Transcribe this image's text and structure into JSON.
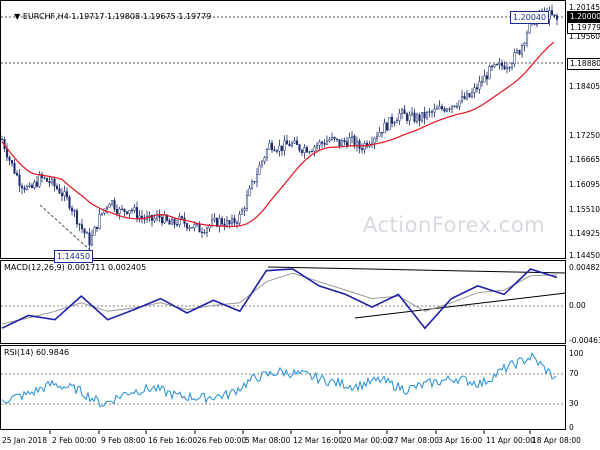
{
  "header": {
    "symbol": "EURCHF,H4",
    "quote": "1.19717 1.19808 1.19675 1.19779"
  },
  "watermark": "ActionForex.com",
  "price_axis": {
    "labels": [
      "1.20145",
      "1.20000",
      "1.19779",
      "1.19560",
      "1.18880",
      "1.18405",
      "1.17250",
      "1.16665",
      "1.16095",
      "1.15510",
      "1.14925",
      "1.14450"
    ],
    "current": "1.19779",
    "level_high": "1.20000",
    "level_support": "1.18880"
  },
  "callouts": {
    "high": "1.20040",
    "low": "1.14450"
  },
  "macd": {
    "label": "MACD(12,26,9) 0.001711 0.002405",
    "axis": [
      "0.004827",
      "0.00",
      "-0.004632"
    ]
  },
  "rsi": {
    "label": "RSI(14) 60.9846",
    "axis": [
      "100",
      "70",
      "30",
      "0"
    ]
  },
  "time_axis": [
    "25 Jan 2018",
    "2 Feb 00:00",
    "9 Feb 08:00",
    "16 Feb 16:00",
    "26 Feb 00:00",
    "5 Mar 08:00",
    "12 Mar 16:00",
    "20 Mar 00:00",
    "27 Mar 08:00",
    "3 Apr 16:00",
    "11 Apr 00:00",
    "18 Apr 08:00"
  ],
  "colors": {
    "price": "#1a2b6e",
    "ma": "#e8121f",
    "macd": "#1f1fa8",
    "signal": "#9a9a9a",
    "rsi": "#1f8fd8",
    "grid": "#000000"
  },
  "chart_data": [
    {
      "type": "line",
      "title": "EURCHF,H4",
      "series": [
        {
          "name": "EURCHF,H4",
          "x": [
            "25 Jan 2018",
            "2 Feb 00:00",
            "9 Feb 08:00",
            "16 Feb 16:00",
            "26 Feb 00:00",
            "5 Mar 08:00",
            "12 Mar 16:00",
            "20 Mar 00:00",
            "27 Mar 08:00",
            "3 Apr 16:00",
            "11 Apr 00:00",
            "18 Apr 08:00"
          ],
          "y": [
            1.166,
            1.162,
            1.148,
            1.152,
            1.151,
            1.159,
            1.167,
            1.168,
            1.174,
            1.178,
            1.184,
            1.199
          ]
        }
      ],
      "ylim": [
        1.1423,
        1.2023
      ],
      "grid": "off"
    },
    {
      "type": "line",
      "title": "MACD(12,26,9) 0.001711 0.002405",
      "series": [
        {
          "values": [
            -0.003,
            -0.0015,
            -0.002,
            0.0008,
            -0.002,
            -0.0008,
            0.0005,
            -0.0012,
            0.0003,
            -0.001,
            0.0038,
            0.004,
            0.002,
            0.001,
            -0.0005,
            0.001,
            -0.003,
            0.0005,
            0.002,
            0.001,
            0.004,
            0.003
          ]
        },
        {
          "values": [
            -0.0025,
            -0.0018,
            -0.001,
            0.0,
            -0.001,
            -0.0006,
            0.0,
            -0.0008,
            -0.0003,
            0.0,
            0.0025,
            0.0035,
            0.0025,
            0.0015,
            0.0005,
            0.0008,
            -0.001,
            0.0,
            0.0012,
            0.0015,
            0.0032,
            0.0033
          ]
        }
      ],
      "ylim": [
        -0.004632,
        0.004827
      ]
    },
    {
      "type": "line",
      "title": "RSI(14) 60.9846",
      "series": [
        {
          "values": [
            35,
            42,
            55,
            48,
            30,
            45,
            50,
            40,
            38,
            42,
            62,
            70,
            66,
            58,
            52,
            60,
            48,
            56,
            62,
            55,
            75,
            88,
            60
          ]
        }
      ],
      "ylim": [
        0,
        100
      ]
    }
  ]
}
